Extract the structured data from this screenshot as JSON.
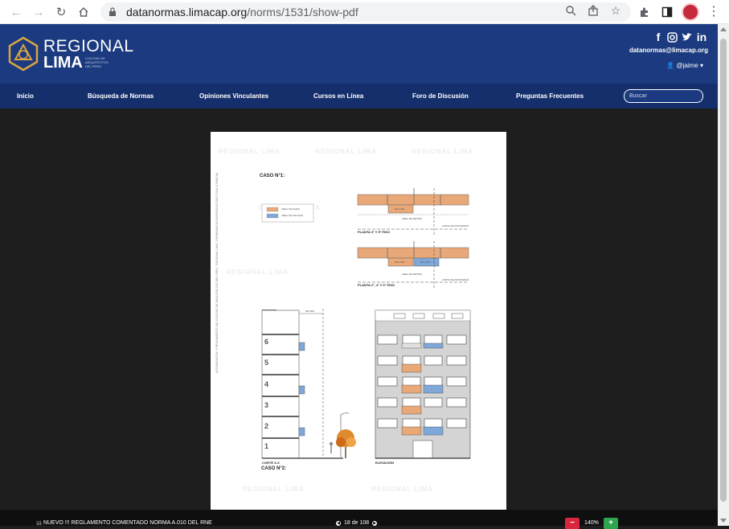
{
  "browser": {
    "url_host": "datanormas.limacap.org",
    "url_path": "/norms/1531/show-pdf",
    "icons": [
      "back-arrow",
      "forward-arrow",
      "reload",
      "home",
      "lock",
      "zoom",
      "share",
      "bookmark-star",
      "extensions",
      "side-panel",
      "profile-avatar",
      "menu-kebab"
    ]
  },
  "header": {
    "logo_line1": "REGIONAL",
    "logo_line2": "LIMA",
    "logo_small": "COLEGIO DE ARQUITECTOS DEL PERÚ",
    "email": "datanormas@limacap.org",
    "user": "@jaime",
    "social": [
      "f",
      "ig",
      "tw",
      "in"
    ]
  },
  "nav": {
    "items": [
      "Inicio",
      "Búsqueda de Normas",
      "Opiniones Vinculantes",
      "Cursos en Línea",
      "Foro de Discusión",
      "Preguntas Frecuentes"
    ],
    "search_placeholder": "Buscar"
  },
  "pdf": {
    "case1": "CASO N°1:",
    "case2": "CASO N°2:",
    "legend": [
      "AREA TECHADA",
      "AREA SIN TECHAR"
    ],
    "plan1_label": "PLANTA 3° Y 5° PISO",
    "plan2_label": "PLANTA 2°, 4° Y 6° PISO",
    "balcon": "BALCON",
    "area_retiro": "AREA DE RETIRO",
    "limite_propiedad": "LIMITE DE PROPIEDAD",
    "retiro": "RETIRO",
    "corte": "CORTE X-X",
    "elevacion": "ELEVACIÓN",
    "floors": [
      "6",
      "5",
      "4",
      "3",
      "2",
      "1"
    ],
    "side_text": "AUTORIZACIÓN: ® REGLAMENTO DEL COLEGIO DE ARQUITECTOS DEL PERÚ - REGIONAL LIMA · PROHIBIDA SU REPRODUCCIÓN TOTAL O PARCIAL",
    "watermark": "REGIONAL LIMA",
    "colors": {
      "techada": "#e8a878",
      "sin_techar": "#7fa8d8"
    }
  },
  "toolbar": {
    "doc_title": "¡¡¡ NUEVO !!! REGLAMENTO COMENTADO NORMA A.010 DEL RNE",
    "page_info": "18 de 108",
    "zoom_minus": "−",
    "zoom_level": "140%",
    "zoom_plus": "+"
  }
}
